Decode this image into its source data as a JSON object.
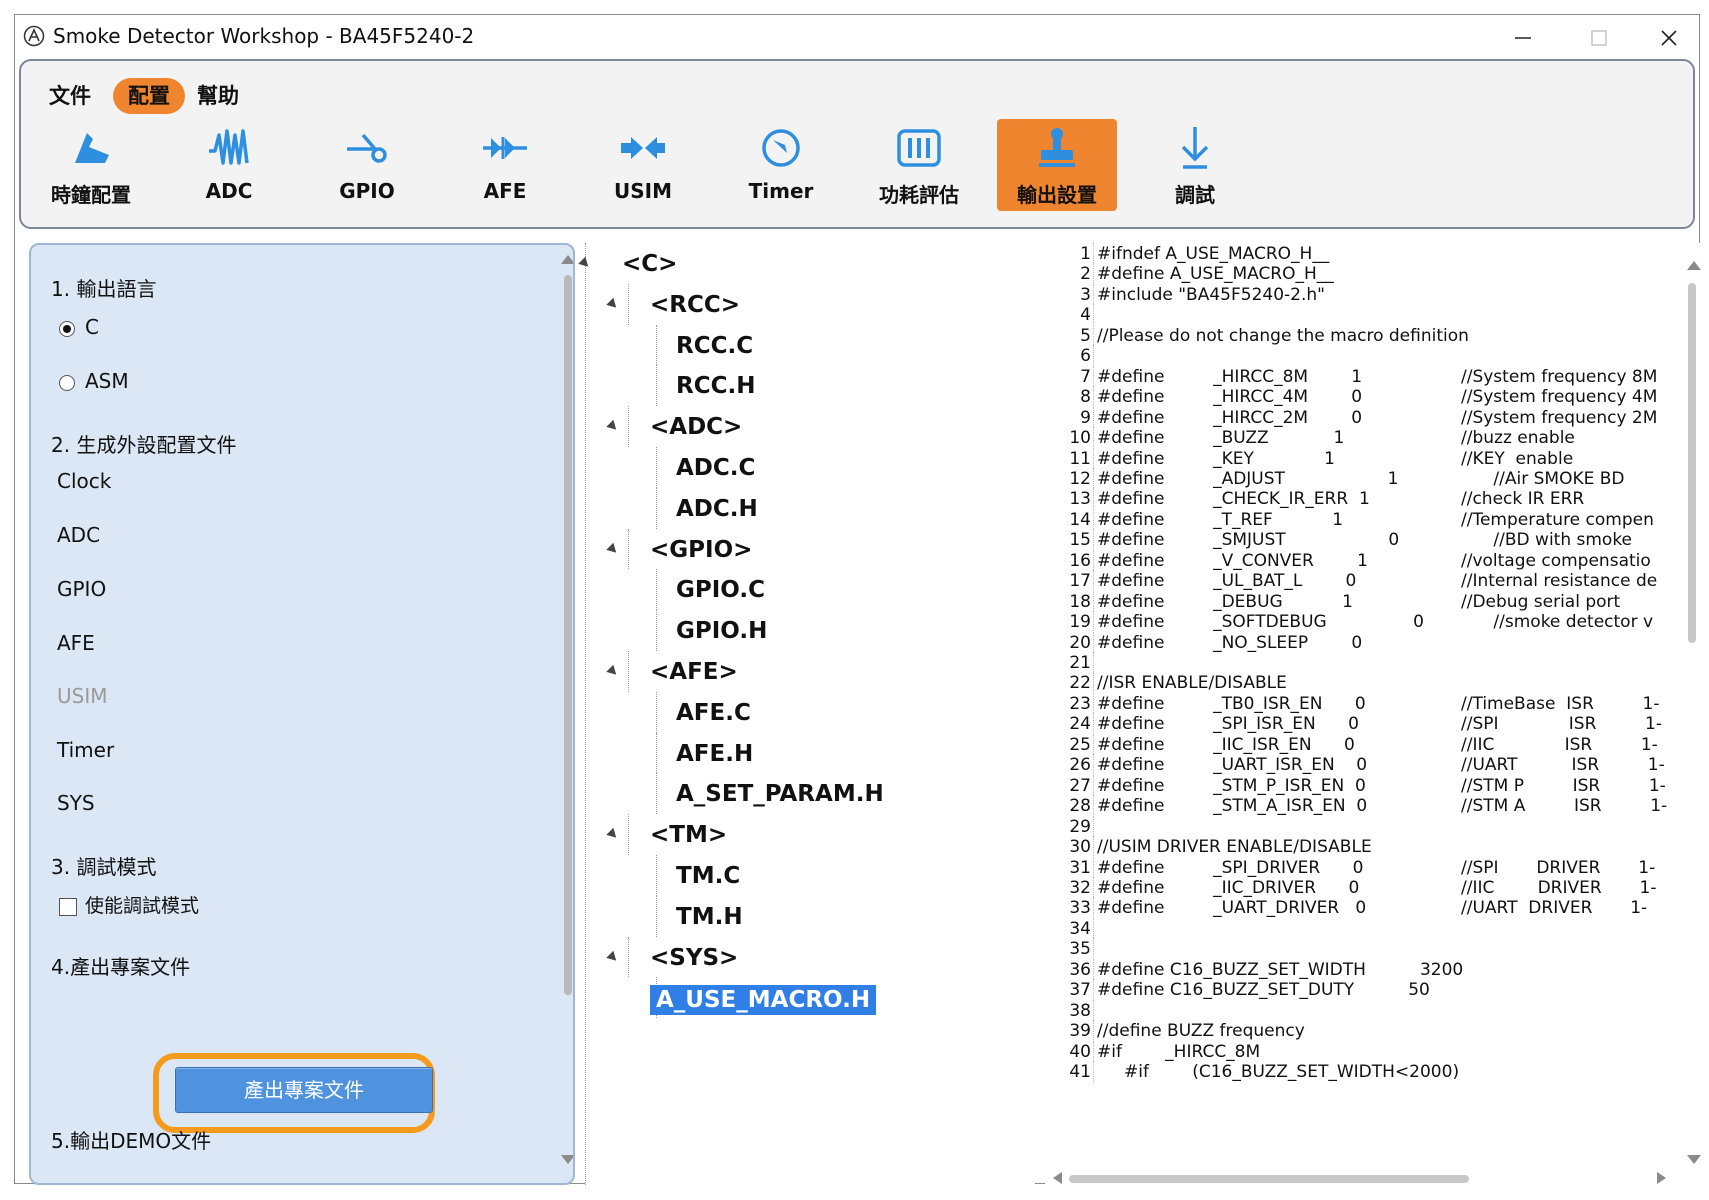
{
  "window": {
    "title": "Smoke Detector Workshop - BA45F5240-2"
  },
  "menu": {
    "file": "文件",
    "config": "配置",
    "help": "幫助"
  },
  "toolbar": {
    "active": "輸出設置",
    "accent_color": "#f0852f",
    "items": [
      {
        "label": "時鐘配置",
        "icon": "clock-config-icon"
      },
      {
        "label": "ADC",
        "icon": "waveform-icon"
      },
      {
        "label": "GPIO",
        "icon": "gpio-pin-icon"
      },
      {
        "label": "AFE",
        "icon": "afe-icon"
      },
      {
        "label": "USIM",
        "icon": "usim-icon"
      },
      {
        "label": "Timer",
        "icon": "timer-icon"
      },
      {
        "label": "功耗評估",
        "icon": "battery-icon"
      },
      {
        "label": "輸出設置",
        "icon": "stamp-icon"
      },
      {
        "label": "調試",
        "icon": "debug-arrow-icon"
      }
    ]
  },
  "left_panel": {
    "section1": "1. 輸出語言",
    "lang_c": "C",
    "lang_asm": "ASM",
    "selected_lang": "C",
    "section2": "2. 生成外設配置文件",
    "peripherals": [
      "Clock",
      "ADC",
      "GPIO",
      "AFE",
      "USIM",
      "Timer",
      "SYS"
    ],
    "disabled_peripheral": "USIM",
    "section3": "3. 調試模式",
    "debug_checkbox": "使能調試模式",
    "debug_checked": false,
    "section4": "4.產出專案文件",
    "generate_button": "產出專案文件",
    "section5": "5.輸出DEMO文件",
    "highlight_color": "#f59a1a"
  },
  "tree": {
    "root": "<C>",
    "groups": [
      {
        "label": "<RCC>",
        "files": [
          "RCC.C",
          "RCC.H"
        ]
      },
      {
        "label": "<ADC>",
        "files": [
          "ADC.C",
          "ADC.H"
        ]
      },
      {
        "label": "<GPIO>",
        "files": [
          "GPIO.C",
          "GPIO.H"
        ]
      },
      {
        "label": "<AFE>",
        "files": [
          "AFE.C",
          "AFE.H",
          "A_SET_PARAM.H"
        ]
      },
      {
        "label": "<TM>",
        "files": [
          "TM.C",
          "TM.H"
        ]
      },
      {
        "label": "<SYS>",
        "files": [
          "A_USE_MACRO.H"
        ]
      }
    ],
    "selected": "A_USE_MACRO.H"
  },
  "code": {
    "lines": [
      {
        "n": "1",
        "t": "#ifndef A_USE_MACRO_H__",
        "c": ""
      },
      {
        "n": "2",
        "t": "#define A_USE_MACRO_H__",
        "c": ""
      },
      {
        "n": "3",
        "t": "#include \"BA45F5240-2.h\"",
        "c": ""
      },
      {
        "n": "4",
        "t": "",
        "c": ""
      },
      {
        "n": "5",
        "t": "//Please do not change the macro definition",
        "c": ""
      },
      {
        "n": "6",
        "t": "",
        "c": ""
      },
      {
        "n": "7",
        "t": "#define         _HIRCC_8M        1",
        "c": "//System frequency 8M"
      },
      {
        "n": "8",
        "t": "#define         _HIRCC_4M        0",
        "c": "//System frequency 4M"
      },
      {
        "n": "9",
        "t": "#define         _HIRCC_2M        0",
        "c": "//System frequency 2M"
      },
      {
        "n": "10",
        "t": "#define         _BUZZ            1",
        "c": "//buzz enable"
      },
      {
        "n": "11",
        "t": "#define         _KEY             1",
        "c": "//KEY  enable"
      },
      {
        "n": "12",
        "t": "#define         _ADJUST                   1",
        "c": "      //Air SMOKE BD"
      },
      {
        "n": "13",
        "t": "#define         _CHECK_IR_ERR  1",
        "c": "//check IR ERR"
      },
      {
        "n": "14",
        "t": "#define         _T_REF           1",
        "c": "//Temperature compen"
      },
      {
        "n": "15",
        "t": "#define         _SMJUST                   0",
        "c": "      //BD with smoke"
      },
      {
        "n": "16",
        "t": "#define         _V_CONVER        1",
        "c": "//voltage compensatio"
      },
      {
        "n": "17",
        "t": "#define         _UL_BAT_L        0",
        "c": "//Internal resistance de"
      },
      {
        "n": "18",
        "t": "#define         _DEBUG           1",
        "c": "//Debug serial port"
      },
      {
        "n": "19",
        "t": "#define         _SOFTDEBUG                0",
        "c": "      //smoke detector v"
      },
      {
        "n": "20",
        "t": "#define         _NO_SLEEP        0",
        "c": ""
      },
      {
        "n": "21",
        "t": "",
        "c": ""
      },
      {
        "n": "22",
        "t": "//ISR ENABLE/DISABLE",
        "c": ""
      },
      {
        "n": "23",
        "t": "#define         _TB0_ISR_EN      0",
        "c": "//TimeBase  ISR         1-"
      },
      {
        "n": "24",
        "t": "#define         _SPI_ISR_EN      0",
        "c": "//SPI             ISR         1-"
      },
      {
        "n": "25",
        "t": "#define         _IIC_ISR_EN      0",
        "c": "//IIC             ISR         1-"
      },
      {
        "n": "26",
        "t": "#define         _UART_ISR_EN    0",
        "c": "//UART          ISR         1-"
      },
      {
        "n": "27",
        "t": "#define         _STM_P_ISR_EN  0",
        "c": "//STM P         ISR         1-"
      },
      {
        "n": "28",
        "t": "#define         _STM_A_ISR_EN  0",
        "c": "//STM A         ISR         1-"
      },
      {
        "n": "29",
        "t": "",
        "c": ""
      },
      {
        "n": "30",
        "t": "//USIM DRIVER ENABLE/DISABLE",
        "c": ""
      },
      {
        "n": "31",
        "t": "#define         _SPI_DRIVER      0",
        "c": "//SPI       DRIVER       1-"
      },
      {
        "n": "32",
        "t": "#define         _IIC_DRIVER      0",
        "c": "//IIC        DRIVER       1-"
      },
      {
        "n": "33",
        "t": "#define         _UART_DRIVER   0",
        "c": "//UART  DRIVER       1-"
      },
      {
        "n": "34",
        "t": "",
        "c": ""
      },
      {
        "n": "35",
        "t": "",
        "c": ""
      },
      {
        "n": "36",
        "t": "#define C16_BUZZ_SET_WIDTH          3200",
        "c": ""
      },
      {
        "n": "37",
        "t": "#define C16_BUZZ_SET_DUTY          50",
        "c": ""
      },
      {
        "n": "38",
        "t": "",
        "c": ""
      },
      {
        "n": "39",
        "t": "//define BUZZ frequency",
        "c": ""
      },
      {
        "n": "40",
        "t": "#if        _HIRCC_8M",
        "c": ""
      },
      {
        "n": "41",
        "t": "     #if        (C16_BUZZ_SET_WIDTH<2000)",
        "c": ""
      }
    ]
  }
}
